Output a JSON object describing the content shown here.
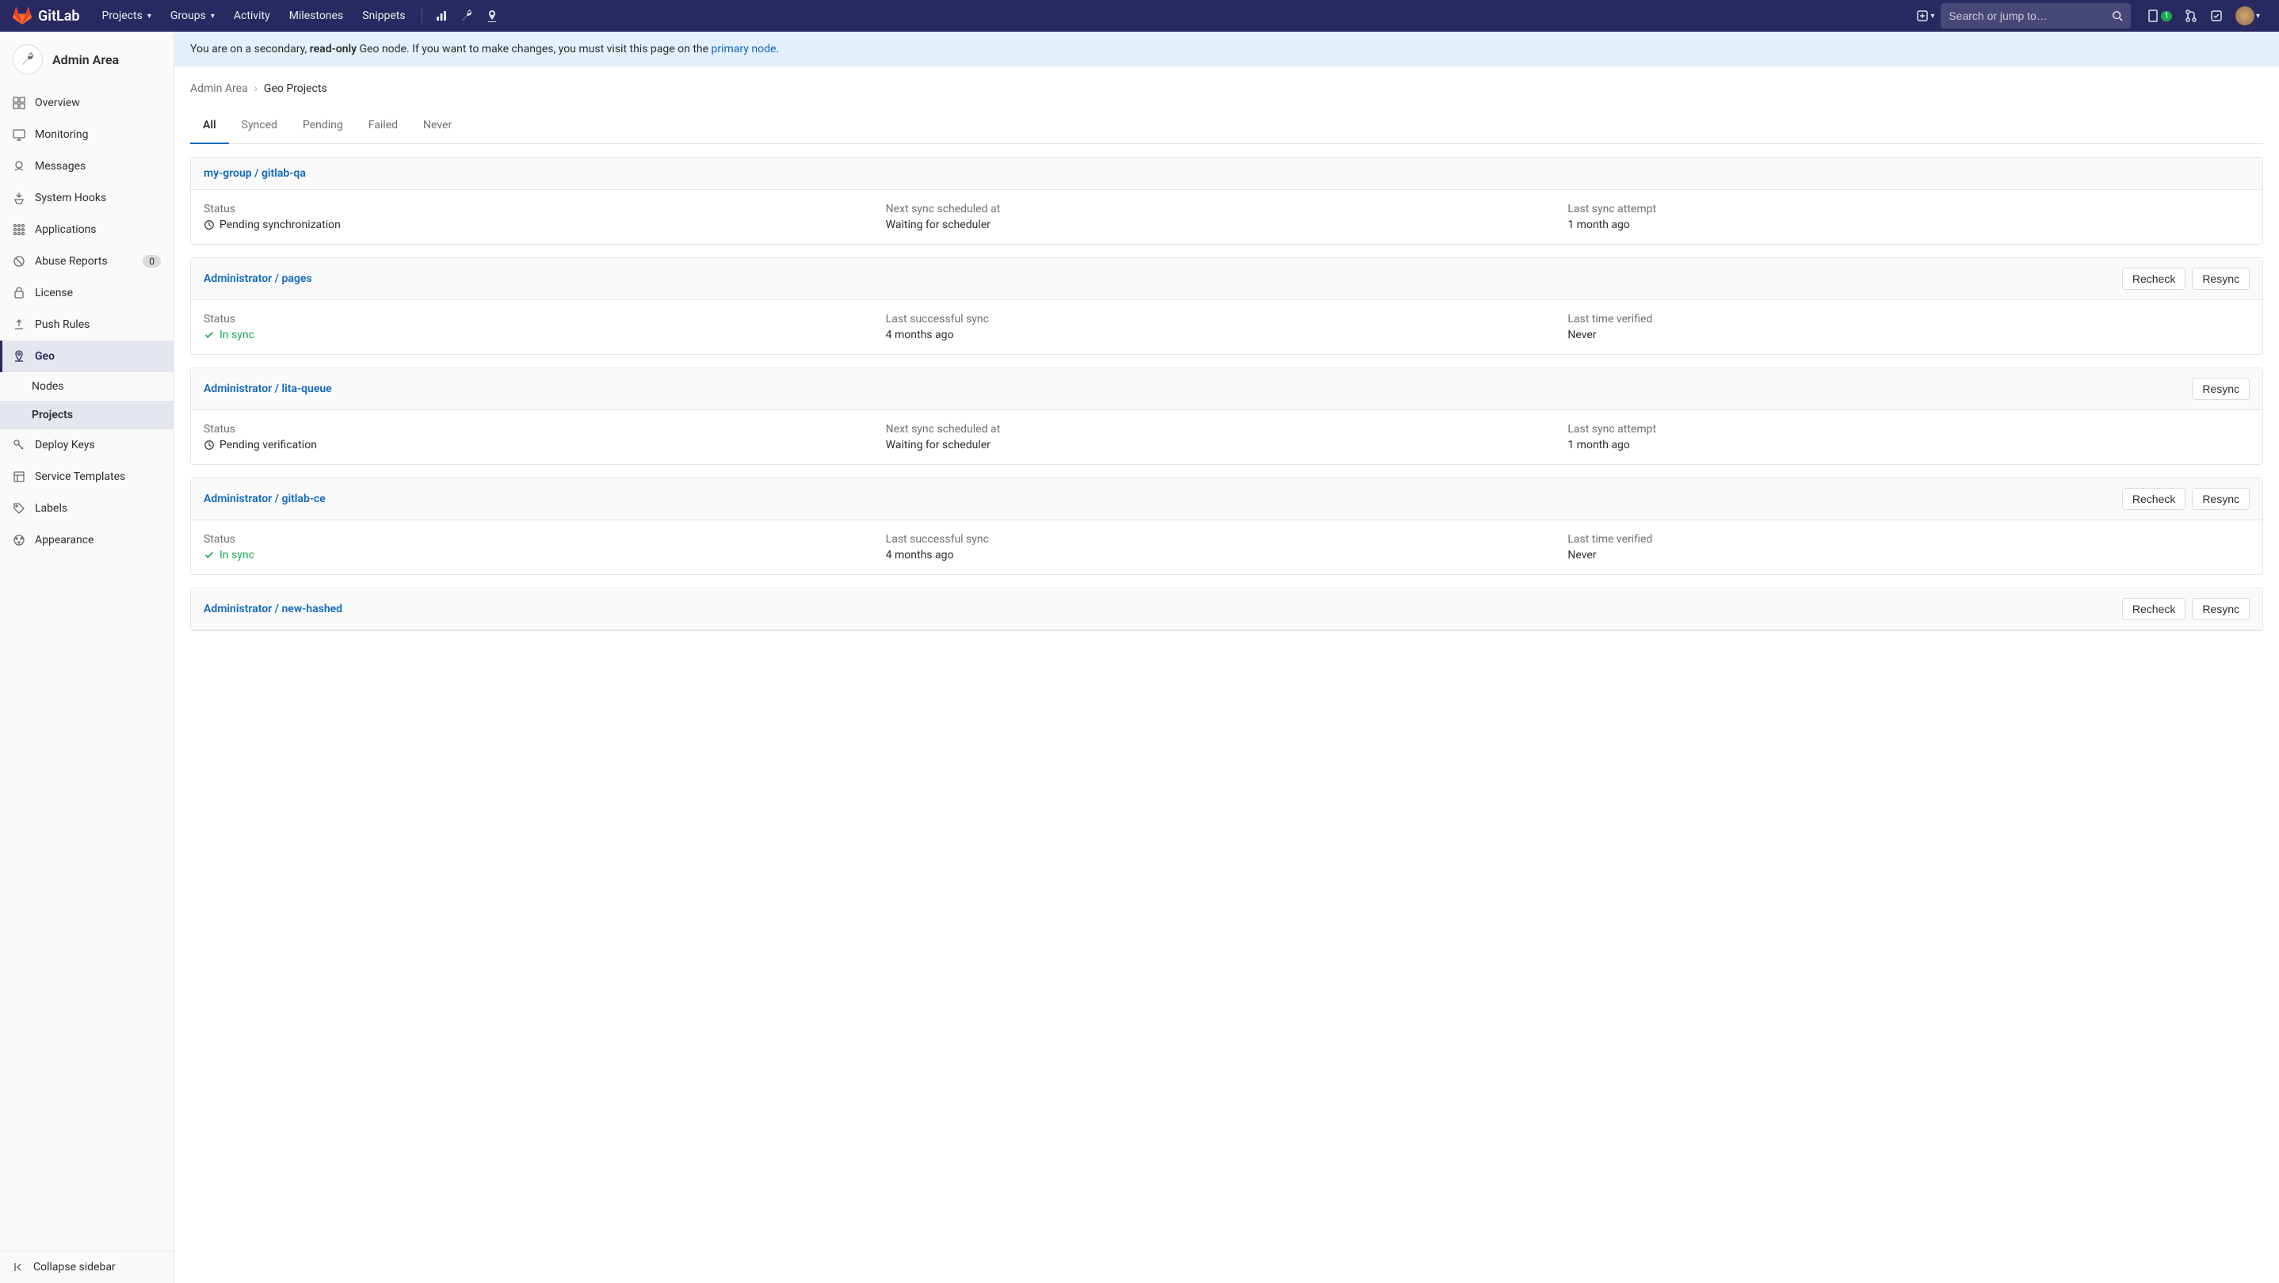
{
  "topnav": {
    "logo_text": "GitLab",
    "links": [
      {
        "label": "Projects",
        "has_caret": true
      },
      {
        "label": "Groups",
        "has_caret": true
      },
      {
        "label": "Activity",
        "has_caret": false
      },
      {
        "label": "Milestones",
        "has_caret": false
      },
      {
        "label": "Snippets",
        "has_caret": false
      }
    ],
    "search_placeholder": "Search or jump to…",
    "issues_badge": "1"
  },
  "sidebar": {
    "title": "Admin Area",
    "items": [
      {
        "icon": "overview",
        "label": "Overview"
      },
      {
        "icon": "monitor",
        "label": "Monitoring"
      },
      {
        "icon": "messages",
        "label": "Messages"
      },
      {
        "icon": "hooks",
        "label": "System Hooks"
      },
      {
        "icon": "apps",
        "label": "Applications"
      },
      {
        "icon": "abuse",
        "label": "Abuse Reports",
        "badge": "0"
      },
      {
        "icon": "license",
        "label": "License"
      },
      {
        "icon": "push",
        "label": "Push Rules"
      },
      {
        "icon": "geo",
        "label": "Geo",
        "active": true
      },
      {
        "icon": "keys",
        "label": "Deploy Keys"
      },
      {
        "icon": "templates",
        "label": "Service Templates"
      },
      {
        "icon": "labels",
        "label": "Labels"
      },
      {
        "icon": "appearance",
        "label": "Appearance"
      }
    ],
    "subitems": [
      {
        "label": "Nodes"
      },
      {
        "label": "Projects",
        "active": true
      }
    ],
    "collapse_label": "Collapse sidebar"
  },
  "banner": {
    "prefix": "You are on a secondary, ",
    "bold": "read-only",
    "mid": " Geo node. If you want to make changes, you must visit this page on the ",
    "link": "primary node",
    "suffix": "."
  },
  "breadcrumb": {
    "parent": "Admin Area",
    "current": "Geo Projects"
  },
  "tabs": [
    {
      "label": "All",
      "active": true
    },
    {
      "label": "Synced"
    },
    {
      "label": "Pending"
    },
    {
      "label": "Failed"
    },
    {
      "label": "Never"
    }
  ],
  "projects": [
    {
      "title": "my-group / gitlab-qa",
      "actions": [],
      "cols": [
        {
          "label": "Status",
          "value": "Pending synchronization",
          "status": "pending",
          "icon": "clock"
        },
        {
          "label": "Next sync scheduled at",
          "value": "Waiting for scheduler"
        },
        {
          "label": "Last sync attempt",
          "value": "1 month ago"
        }
      ]
    },
    {
      "title": "Administrator / pages",
      "actions": [
        "Recheck",
        "Resync"
      ],
      "cols": [
        {
          "label": "Status",
          "value": "In sync",
          "status": "insync",
          "icon": "check"
        },
        {
          "label": "Last successful sync",
          "value": "4 months ago"
        },
        {
          "label": "Last time verified",
          "value": "Never"
        }
      ]
    },
    {
      "title": "Administrator / lita-queue",
      "actions": [
        "Resync"
      ],
      "cols": [
        {
          "label": "Status",
          "value": "Pending verification",
          "status": "pending",
          "icon": "clock"
        },
        {
          "label": "Next sync scheduled at",
          "value": "Waiting for scheduler"
        },
        {
          "label": "Last sync attempt",
          "value": "1 month ago"
        }
      ]
    },
    {
      "title": "Administrator / gitlab-ce",
      "actions": [
        "Recheck",
        "Resync"
      ],
      "cols": [
        {
          "label": "Status",
          "value": "In sync",
          "status": "insync",
          "icon": "check"
        },
        {
          "label": "Last successful sync",
          "value": "4 months ago"
        },
        {
          "label": "Last time verified",
          "value": "Never"
        }
      ]
    },
    {
      "title": "Administrator / new-hashed",
      "actions": [
        "Recheck",
        "Resync"
      ],
      "cols": []
    }
  ]
}
